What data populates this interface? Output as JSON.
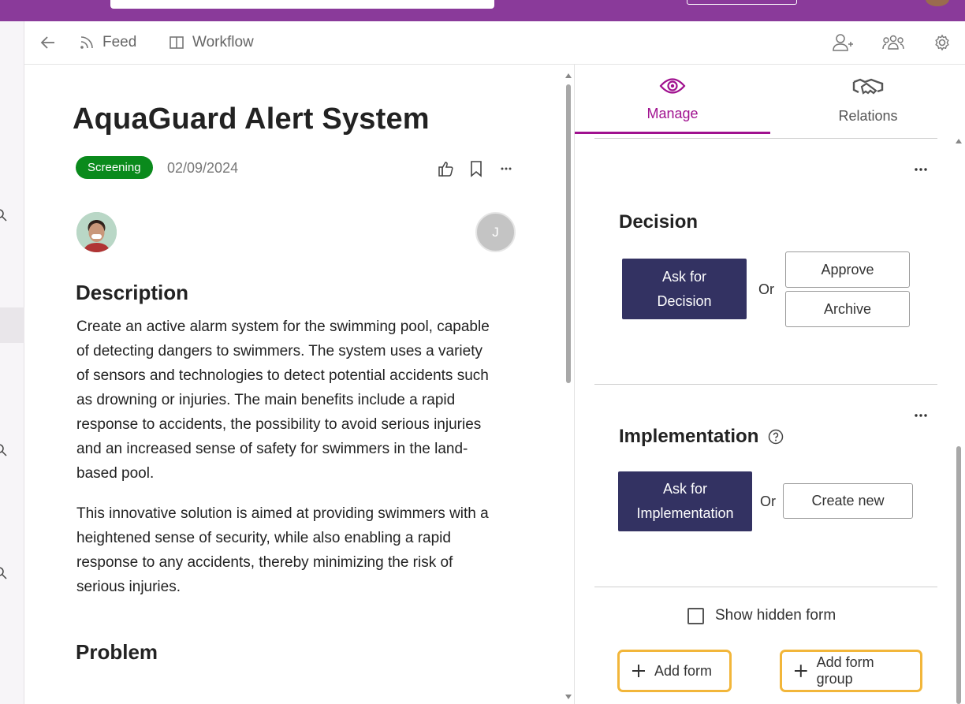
{
  "nav": {
    "feed_label": "Feed",
    "workflow_label": "Workflow"
  },
  "idea": {
    "title": "AquaGuard Alert System",
    "status": "Screening",
    "date": "02/09/2024",
    "assignee_initial": "J"
  },
  "description": {
    "heading": "Description",
    "paragraph1": "Create an active alarm system for the swimming pool, capable of detecting dangers to swimmers. The system uses a variety of sensors and technologies to detect potential accidents such as drowning or injuries. The main benefits include a rapid response to accidents, the possibility to avoid serious injuries and an increased sense of safety for swimmers in the land-based pool.",
    "paragraph2": "This innovative solution is aimed at providing swimmers with a heightened sense of security, while also enabling a rapid response to any accidents, thereby minimizing the risk of serious injuries."
  },
  "problem": {
    "heading": "Problem"
  },
  "tabs": {
    "manage": "Manage",
    "relations": "Relations"
  },
  "decision": {
    "title": "Decision",
    "ask_label": "Ask for Decision",
    "or": "Or",
    "approve": "Approve",
    "archive": "Archive"
  },
  "implementation": {
    "title": "Implementation",
    "ask_label": "Ask for Implementation",
    "or": "Or",
    "create_new": "Create new"
  },
  "forms": {
    "show_hidden": "Show hidden form",
    "add_form": "Add form",
    "add_form_group": "Add form group"
  },
  "icons": {
    "back": "arrow-left-icon",
    "feed": "rss-icon",
    "workflow": "columns-icon",
    "add_user": "add-user-icon",
    "team": "team-icon",
    "settings": "gear-icon",
    "like": "thumbs-up-icon",
    "bookmark": "bookmark-icon",
    "more": "more-icon",
    "manage": "eye-icon",
    "relations": "handshake-icon",
    "help": "help-icon",
    "plus": "plus-icon"
  },
  "colors": {
    "topbar": "#8a3a9a",
    "accent": "#a0118f",
    "status_green": "#0a8a1c",
    "primary_button": "#333262",
    "highlight": "#f2b63a"
  }
}
